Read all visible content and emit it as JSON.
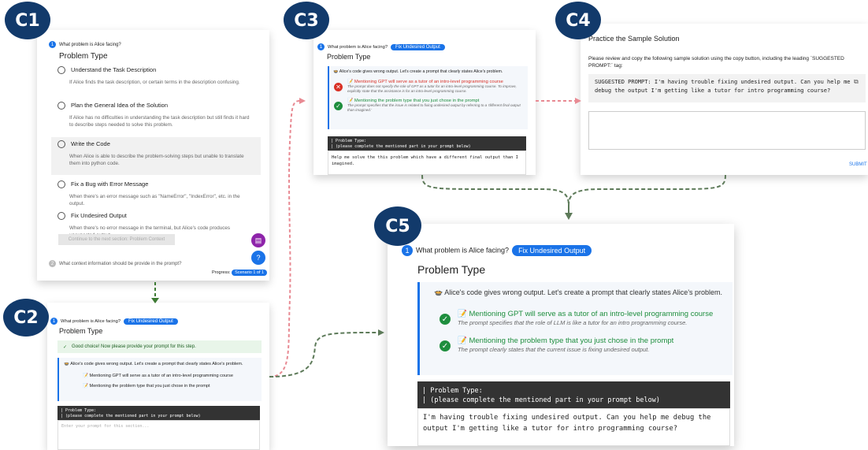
{
  "badges": {
    "c1": "C1",
    "c2": "C2",
    "c3": "C3",
    "c4": "C4",
    "c5": "C5"
  },
  "c1": {
    "question": "What problem is Alice facing?",
    "title": "Problem Type",
    "options": [
      {
        "label": "Understand the Task Description",
        "desc": "If Alice finds the task description, or certain terms in the description confusing."
      },
      {
        "label": "Plan the General Idea of the Solution",
        "desc": "If Alice has no difficulties in understanding the task description but still finds it hard to describe steps needed to solve this problem."
      },
      {
        "label": "Write the Code",
        "desc": "When Alice is able to describe the problem-solving steps but unable to translate them into python code."
      },
      {
        "label": "Fix a Bug with Error Message",
        "desc": "When there's an error message such as \"NameError\", \"IndexError\", etc. in the output."
      },
      {
        "label": "Fix Undesired Output",
        "desc": "When there's no error message in the terminal, but Alice's code produces unexpected output."
      }
    ],
    "continue_label": "Continue to the next section: Problem Context",
    "next_question": "What context information should be provide in the prompt?",
    "progress_label": "Progress:",
    "progress_value": "Scenario 1 of 1"
  },
  "c2": {
    "question": "What problem is Alice facing?",
    "pill": "Fix Undesired Output",
    "title": "Problem Type",
    "success": "Good choice! Now please provide your prompt for this step.",
    "intro": "Alice's code gives wrong output. Let's create a prompt that clearly states Alice's problem.",
    "checks": [
      "Mentioning GPT will serve as a tutor of an intro-level programming course",
      "Mentioning the problem type that you just chose in the prompt"
    ],
    "code_line1": "| Problem Type:",
    "code_line2": "| (please complete the mentioned part in your prompt below)",
    "placeholder": "Enter your prompt for this section..."
  },
  "c3": {
    "question": "What problem is Alice facing?",
    "pill": "Fix Undesired Output",
    "title": "Problem Type",
    "intro": "Alice's code gives wrong output. Let's create a prompt that clearly states Alice's problem.",
    "item1_title": "Mentioning GPT will serve as a tutor of an intro-level programming course",
    "item1_desc": "The prompt does not specify the role of GPT as a tutor for an intro-level programming course. To improve, explicitly state that the assistance is for an intro-level programming course.",
    "item2_title": "Mentioning the problem type that you just chose in the prompt",
    "item2_desc": "The prompt specifies that the issue is related to fixing undesired output by referring to a 'different final output than imagined.'",
    "code_line1": "| Problem Type:",
    "code_line2": "| (please complete the mentioned part in your prompt below)",
    "answer": "Help me solve the this problem which have a different final output than I imagined."
  },
  "c4": {
    "title": "Practice the Sample Solution",
    "instruction": "Please review and copy the following sample solution using the copy button, including the leading `SUGGESTED PROMPT:` tag:",
    "solution": "SUGGESTED PROMPT: I'm having trouble fixing undesired output. Can you help me debug the output I'm getting like a tutor for intro programming course?",
    "submit": "SUBMIT"
  },
  "c5": {
    "question": "What problem is Alice facing?",
    "pill": "Fix Undesired Output",
    "title": "Problem Type",
    "intro": "Alice's code gives wrong output. Let's create a prompt that clearly states Alice's problem.",
    "item1_title": "Mentioning GPT will serve as a tutor of an intro-level programming course",
    "item1_desc": "The prompt specifies that the role of LLM is like a tutor for an intro programming course.",
    "item2_title": "Mentioning the problem type that you just chose in the prompt",
    "item2_desc": "The prompt clearly states that the current issue is fixing undesired output.",
    "code_line1": "| Problem Type:",
    "code_line2": "| (please complete the mentioned part in your prompt below)",
    "answer": "I'm having trouble fixing undesired output. Can you help me debug the output I'm getting like a tutor for intro programming course?"
  }
}
